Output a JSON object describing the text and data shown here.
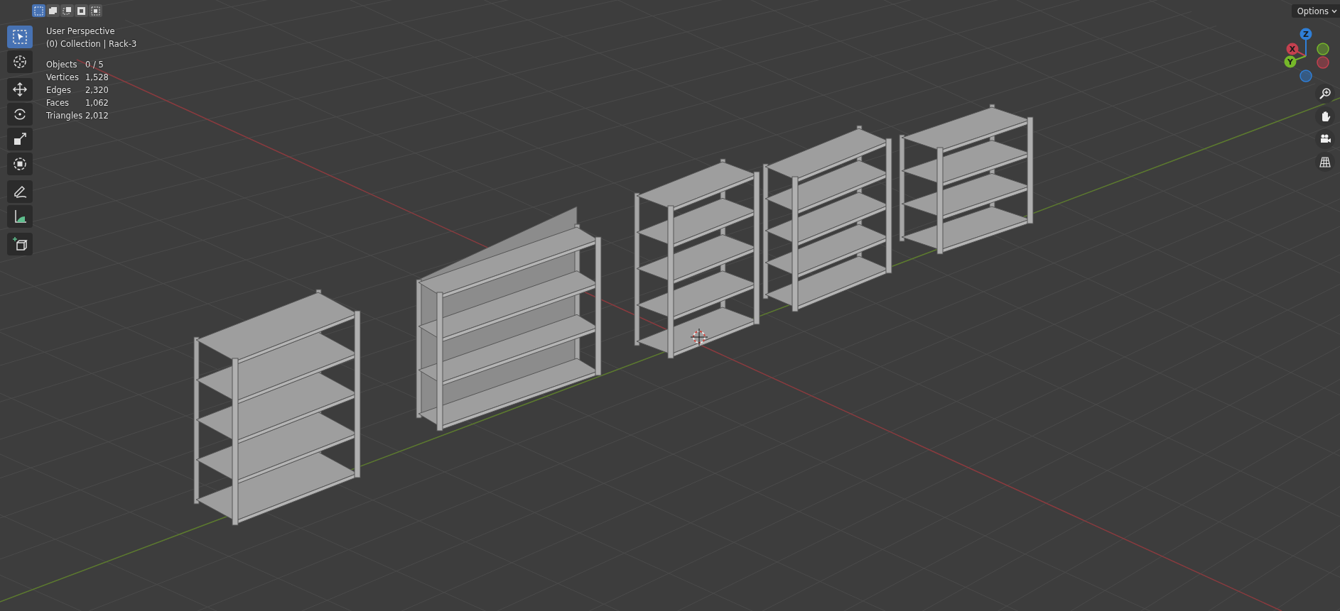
{
  "header": {
    "select_modes": [
      {
        "selected": true
      },
      {
        "selected": false
      },
      {
        "selected": false
      },
      {
        "selected": false
      },
      {
        "selected": false
      }
    ],
    "options_button": {
      "label": "Options"
    }
  },
  "toolbar": {
    "groups": [
      {
        "tools": [
          {
            "selected": true
          },
          {
            "selected": false
          }
        ]
      },
      {
        "tools": [
          {
            "selected": false
          },
          {
            "selected": false
          },
          {
            "selected": false
          },
          {
            "selected": false
          }
        ]
      },
      {
        "tools": [
          {
            "selected": false
          },
          {
            "selected": false
          }
        ]
      },
      {
        "tools": [
          {
            "selected": false
          }
        ]
      }
    ]
  },
  "overlay": {
    "view": "User Perspective",
    "collection": "(0) Collection | Rack-3",
    "stats": [
      {
        "label": "Objects",
        "value": "0 / 5"
      },
      {
        "label": "Vertices",
        "value": "1,528"
      },
      {
        "label": "Edges",
        "value": "2,320"
      },
      {
        "label": "Faces",
        "value": "1,062"
      },
      {
        "label": "Triangles",
        "value": "2,012"
      }
    ]
  },
  "gizmo": {
    "axes": [
      {
        "label": "Z",
        "color": "#2f7fd8"
      },
      {
        "label": "X",
        "color": "#c4404f"
      },
      {
        "label": "Y",
        "color": "#76b82a"
      }
    ]
  }
}
